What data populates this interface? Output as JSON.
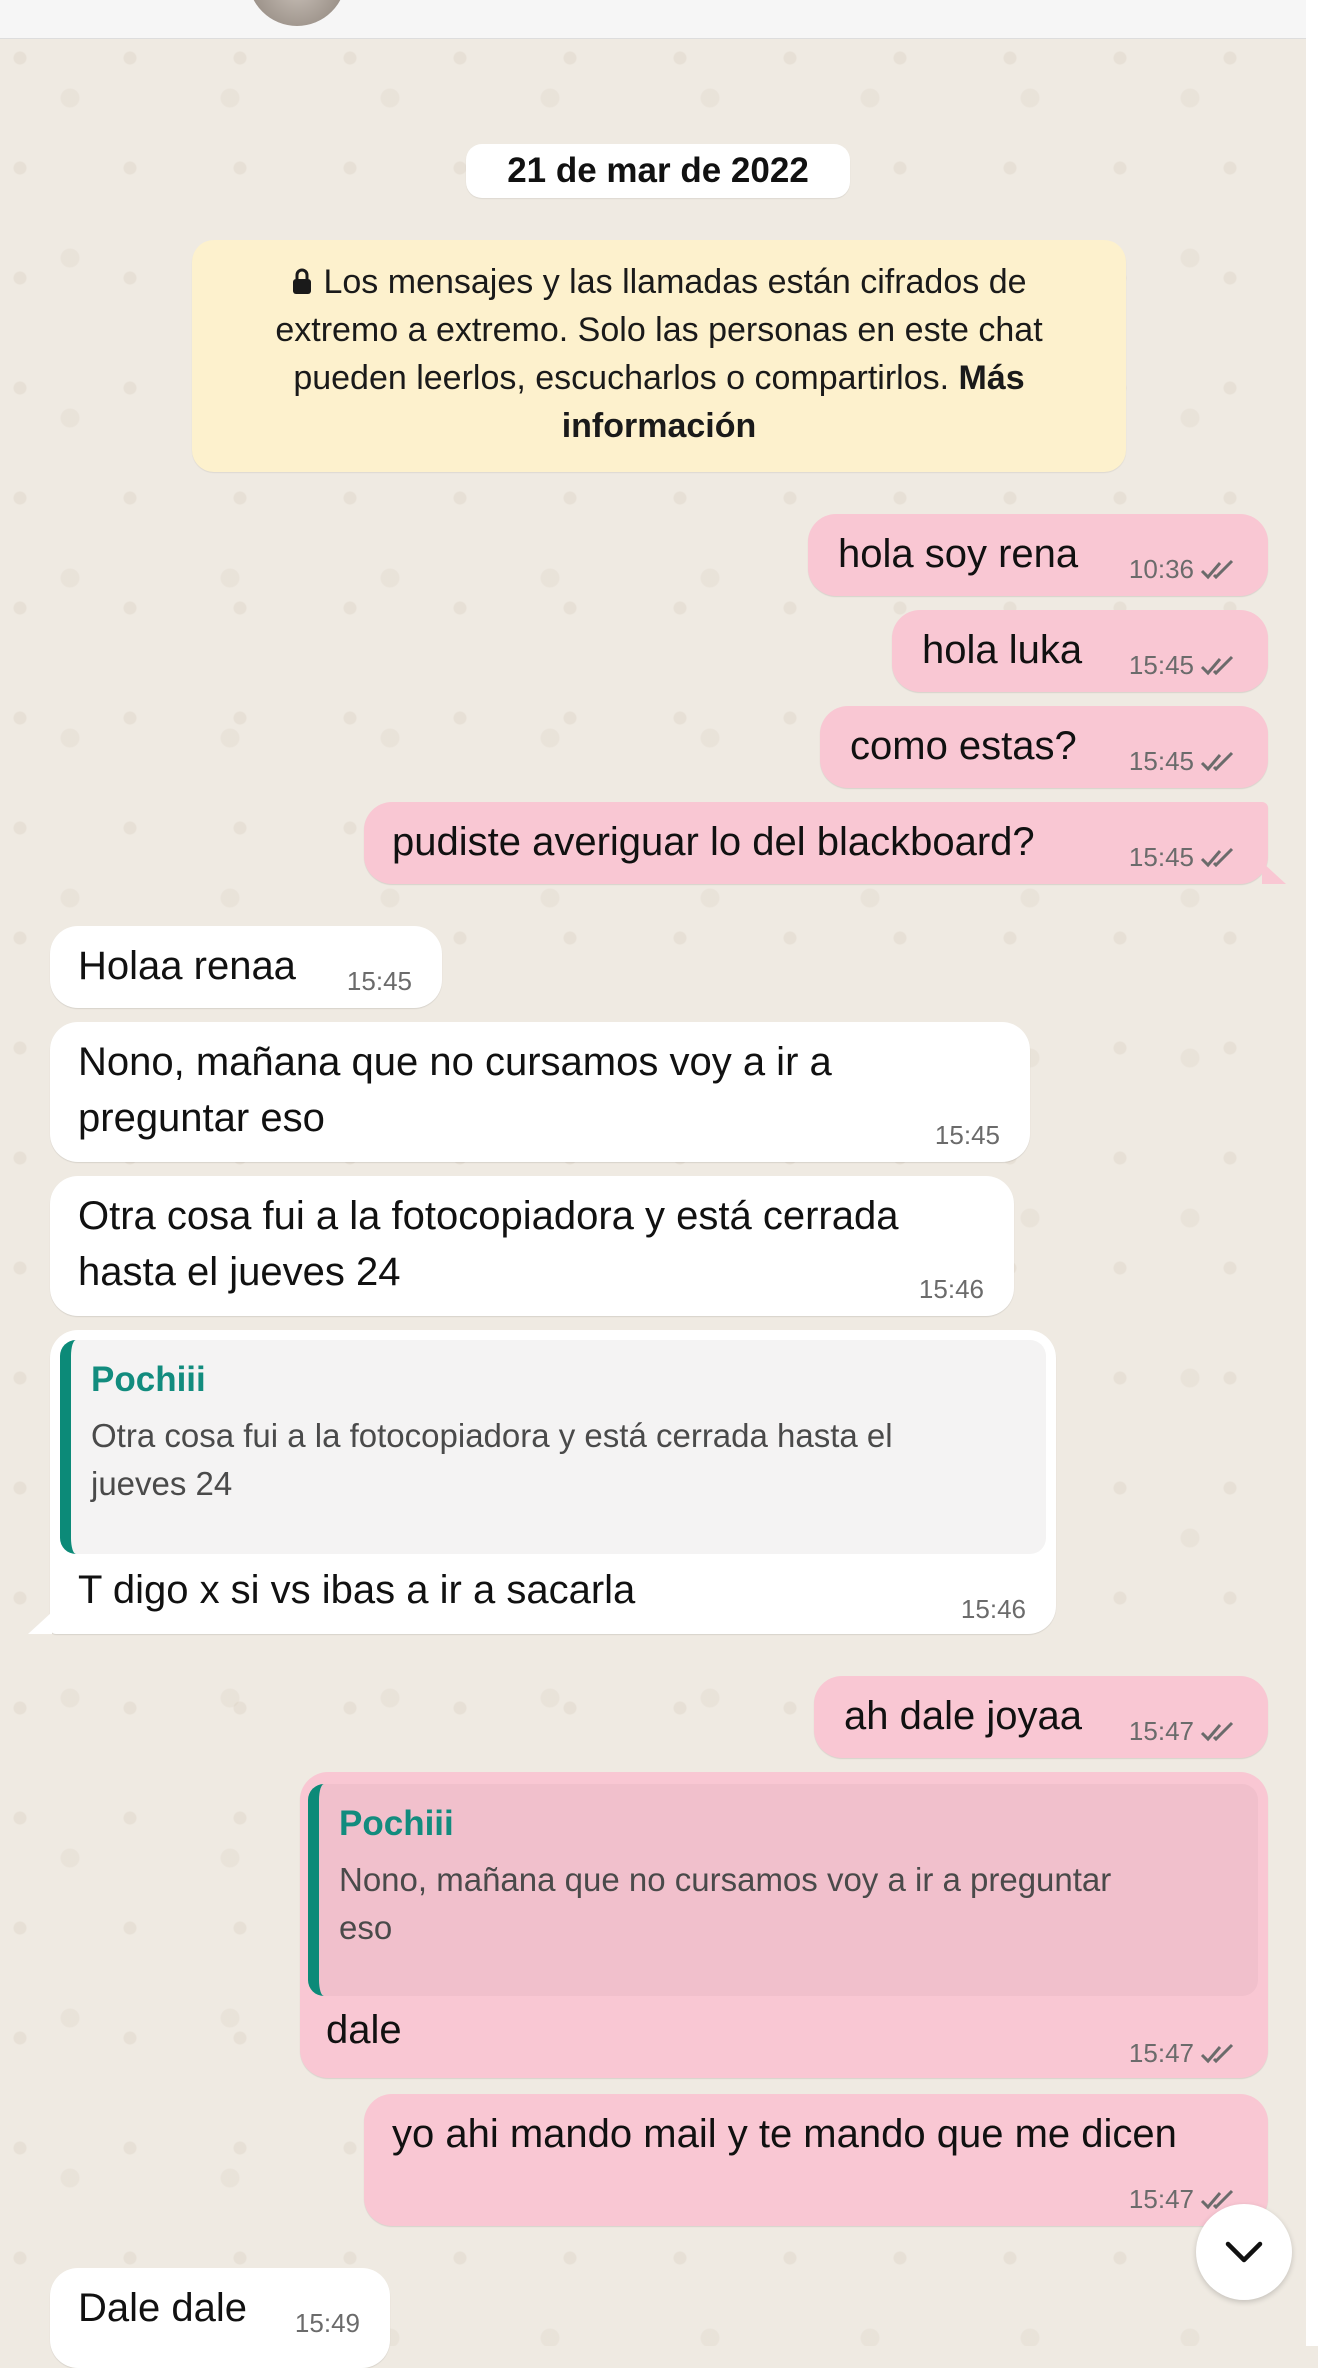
{
  "date_chip": "21 de mar de 2022",
  "encryption_notice": {
    "text": "Los mensajes y las llamadas están cifrados de extremo a extremo. Solo las personas en este chat pueden leerlos, escucharlos o compartirlos.",
    "link": "Más información"
  },
  "messages": [
    {
      "direction": "out",
      "text": "hola soy rena",
      "time": "10:36",
      "status": "read"
    },
    {
      "direction": "out",
      "text": "hola luka",
      "time": "15:45",
      "status": "read"
    },
    {
      "direction": "out",
      "text": "como estas?",
      "time": "15:45",
      "status": "read"
    },
    {
      "direction": "out",
      "text": "pudiste averiguar lo del blackboard?",
      "time": "15:45",
      "status": "read"
    },
    {
      "direction": "in",
      "text": "Holaa renaa",
      "time": "15:45"
    },
    {
      "direction": "in",
      "text_line1": "Nono, mañana que no cursamos voy a ir a",
      "text_line2": "preguntar eso",
      "time": "15:45"
    },
    {
      "direction": "in",
      "text_line1": "Otra cosa fui a la fotocopiadora y está cerrada",
      "text_line2": "hasta el jueves 24",
      "time": "15:46"
    },
    {
      "direction": "in",
      "quote_author": "Pochiii",
      "quote_line1": "Otra cosa fui a la fotocopiadora y está cerrada hasta el",
      "quote_line2": "jueves 24",
      "text": "T digo x si vs ibas a ir a sacarla",
      "time": "15:46"
    },
    {
      "direction": "out",
      "text": "ah dale joyaa",
      "time": "15:47",
      "status": "read"
    },
    {
      "direction": "out",
      "quote_author": "Pochiii",
      "quote_line1": "Nono, mañana que no cursamos voy a ir a preguntar",
      "quote_line2": "eso",
      "text": "dale",
      "time": "15:47",
      "status": "read"
    },
    {
      "direction": "out",
      "text": "yo ahi mando mail y te mando que me dicen",
      "time": "15:47",
      "status": "read"
    },
    {
      "direction": "in",
      "text": "Dale dale",
      "time": "15:49"
    }
  ],
  "icons": {
    "lock": "lock-icon",
    "read_receipt": "double-check-icon",
    "scroll_down": "chevron-down-icon"
  },
  "colors": {
    "outgoing_bubble": "#f9c7d3",
    "incoming_bubble": "#ffffff",
    "quote_bar": "#0c8a78",
    "quote_author": "#128c7e",
    "notice_bg": "#fdf1cd"
  }
}
